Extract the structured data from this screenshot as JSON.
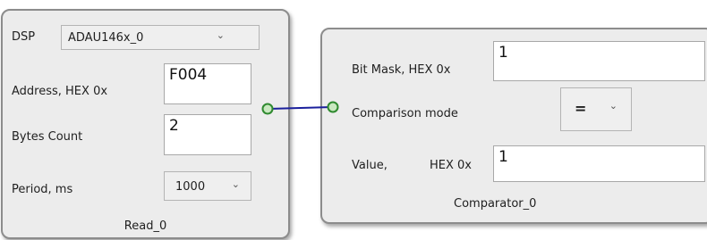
{
  "read_block": {
    "title": "Read_0",
    "dsp_label": "DSP",
    "dsp_value": "ADAU146x_0",
    "address_label": "Address, HEX  0x",
    "address_value": "F004",
    "bytes_label": "Bytes Count",
    "bytes_value": "2",
    "period_label": "Period, ms",
    "period_value": "1000"
  },
  "comparator_block": {
    "title": "Comparator_0",
    "bitmask_label": "Bit Mask, HEX 0x",
    "bitmask_value": "1",
    "mode_label": "Comparison mode",
    "mode_value": "=",
    "value_label": "Value,",
    "value_hex_label": "HEX 0x",
    "value_value": "1"
  },
  "icons": {
    "dropdown": "chevron-down-icon",
    "port": "connector-port-icon"
  },
  "colors": {
    "wire": "#1a1f9c",
    "port_outline": "#2f8a2f",
    "port_fill": "#c9e8c0"
  }
}
